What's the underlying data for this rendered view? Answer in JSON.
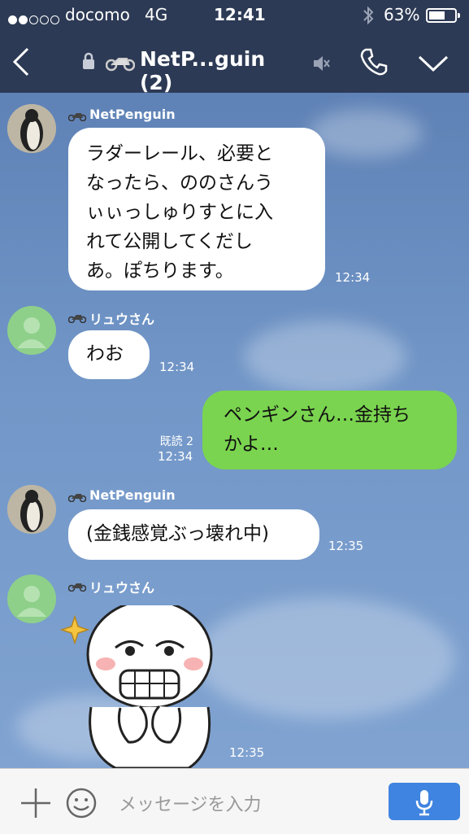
{
  "status": {
    "carrier": "docomo",
    "network": "4G",
    "time": "12:41",
    "battery": "63%",
    "battery_level": 0.63
  },
  "header": {
    "back_icon": "chevron-left-icon",
    "title": "NetP...guin (2)",
    "mute_icon": "speaker-mute-icon",
    "call_icon": "phone-icon",
    "menu_icon": "chevron-down-icon"
  },
  "messages": [
    {
      "sender": "NetPenguin",
      "lines": [
        "ラダーレール、必要と",
        "なったら、ののさんう",
        "ぃぃっしゅりすとに入",
        "れて公開してくだし",
        "あ。ぽちります。"
      ],
      "time": "12:34"
    },
    {
      "sender": "リュウさん",
      "lines": [
        "わお"
      ],
      "time": "12:34"
    },
    {
      "sender": "me",
      "lines": [
        "ペンギンさん…金持ち",
        "かよ…"
      ],
      "read": "既読 2",
      "time": "12:34"
    },
    {
      "sender": "NetPenguin",
      "lines": [
        "(金銭感覚ぶっ壊れ中)"
      ],
      "time": "12:35"
    },
    {
      "sender": "リュウさん",
      "sticker": "grinning-face-sticker",
      "time": "12:35"
    }
  ],
  "input": {
    "add_icon": "plus-icon",
    "emoji_icon": "smiley-icon",
    "placeholder": "メッセージを入力",
    "mic_icon": "microphone-icon"
  },
  "colors": {
    "header": "#2d3a55",
    "my_bubble": "#7ad44f",
    "other_bubble": "#ffffff",
    "mic_button": "#3f84e0"
  }
}
